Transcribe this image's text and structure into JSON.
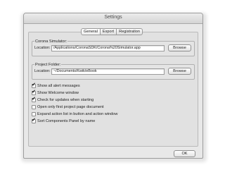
{
  "window": {
    "title": "Settings"
  },
  "tabs": [
    {
      "label": "General",
      "active": true
    },
    {
      "label": "Export",
      "active": false
    },
    {
      "label": "Registration",
      "active": false
    }
  ],
  "corona_simulator": {
    "label": "Corona Simulator:",
    "location_label": "Location:",
    "value": "/Applications/CoronaSDK/Corona%20Simulator.app",
    "browse_label": "Browse"
  },
  "project_folder": {
    "label": "Project Folder:",
    "location_label": "Location:",
    "value": "~/Documents/Kwik/eBook",
    "browse_label": "Browse"
  },
  "options": [
    {
      "label": "Show all alert messages",
      "checked": true
    },
    {
      "label": "Show Welcome window",
      "checked": true
    },
    {
      "label": "Check for updates when starting",
      "checked": true
    },
    {
      "label": "Open only first project page document",
      "checked": false
    },
    {
      "label": "Expand action list in button and action window",
      "checked": false
    },
    {
      "label": "Sort Components Panel by name",
      "checked": true
    }
  ],
  "ok_label": "OK"
}
